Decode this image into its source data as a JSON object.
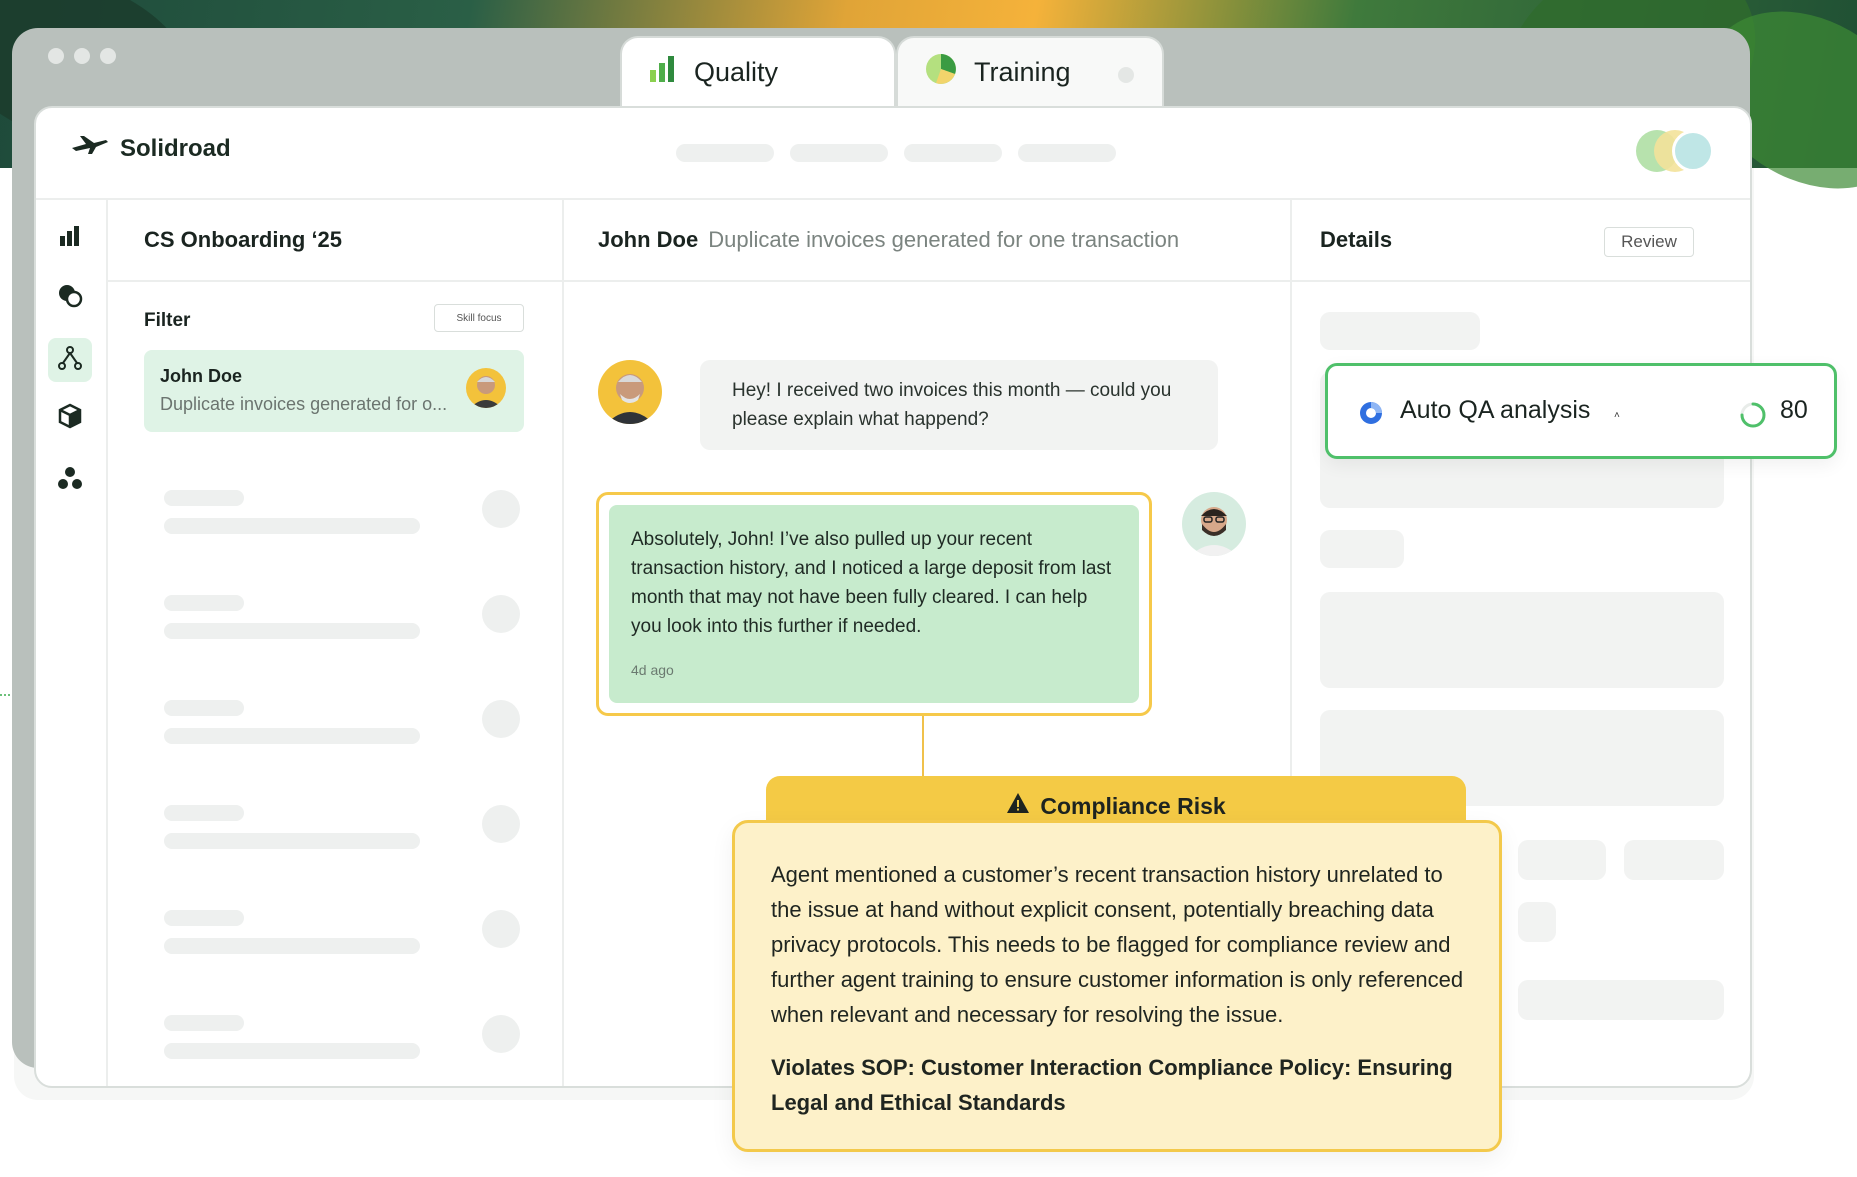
{
  "tabs": [
    {
      "label": "Quality",
      "icon": "bar-chart-icon",
      "active": true
    },
    {
      "label": "Training",
      "icon": "pie-chart-icon",
      "active": false
    }
  ],
  "app": {
    "brand": "Solidroad",
    "brand_icon": "plane-icon"
  },
  "sidebar": {
    "items": [
      {
        "icon": "bar-chart-icon",
        "active": false
      },
      {
        "icon": "chat-bubbles-icon",
        "active": false
      },
      {
        "icon": "branch-icon",
        "active": true
      },
      {
        "icon": "cube-icon",
        "active": false
      },
      {
        "icon": "cluster-icon",
        "active": false
      }
    ]
  },
  "list": {
    "title": "CS Onboarding ‘25",
    "filter_label": "Filter",
    "skill_focus_label": "Skill focus",
    "selected": {
      "name": "John Doe",
      "preview": "Duplicate invoices generated for o..."
    }
  },
  "chat": {
    "customer_name": "John Doe",
    "subject": "Duplicate invoices generated for one transaction",
    "customer_message": "Hey! I received two invoices this month — could you please explain what happend?",
    "agent_message": "Absolutely, John! I’ve also pulled up your recent transaction history, and I noticed a large deposit from last month that may not have been fully cleared. I can help you look into this further if needed.",
    "agent_time": "4d ago"
  },
  "details": {
    "title": "Details",
    "review_label": "Review"
  },
  "qa": {
    "label": "Auto QA analysis",
    "caret": "˄",
    "score": "80"
  },
  "compliance": {
    "title": "Compliance Risk",
    "body": "Agent mentioned a customer’s recent transaction history unrelated to the issue at hand without explicit consent, potentially breaching data privacy protocols. This needs to be flagged for compliance review and further agent training to ensure customer information is only referenced when relevant and necessary for resolving the issue.",
    "sop": "Violates SOP: Customer Interaction Compliance Policy: Ensuring Legal and Ethical Standards"
  },
  "colors": {
    "accent_green": "#4fc06a",
    "selected_bg": "#dff3e6",
    "agent_bubble": "#c7ebcd",
    "warning_yellow": "#f4ca45",
    "warning_bg": "#fdf1c9"
  }
}
